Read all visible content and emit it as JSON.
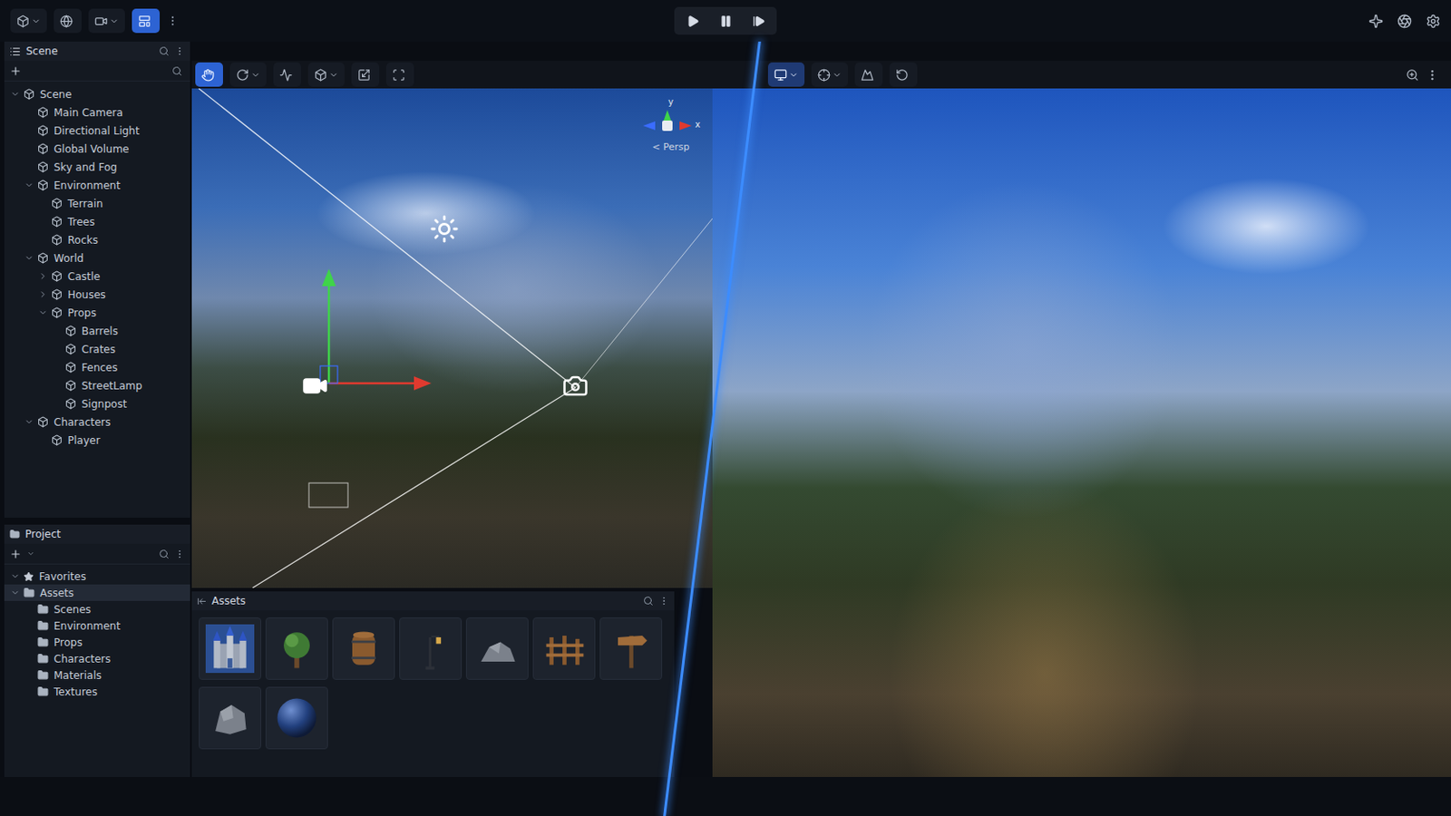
{
  "top_bar": {
    "left_tools": [
      {
        "kind": "cube",
        "dropdown": true,
        "selected": false
      },
      {
        "kind": "globe",
        "dropdown": false,
        "selected": false
      },
      {
        "kind": "camera",
        "dropdown": true,
        "selected": false
      },
      {
        "kind": "layout",
        "dropdown": false,
        "selected": true
      }
    ],
    "playback": [
      {
        "kind": "play"
      },
      {
        "kind": "pause"
      },
      {
        "kind": "step"
      }
    ],
    "right_tools": [
      {
        "kind": "sparkle"
      },
      {
        "kind": "aperture"
      },
      {
        "kind": "settings"
      }
    ]
  },
  "hierarchy": {
    "title": "Scene",
    "search": {
      "placeholder": ""
    },
    "items": [
      {
        "label": "Scene",
        "expandable": true,
        "expanded": true,
        "selected": false,
        "children": [
          {
            "label": "Main Camera",
            "expandable": false,
            "expanded": false,
            "selected": false,
            "children": []
          },
          {
            "label": "Directional Light",
            "expandable": false,
            "expanded": false,
            "selected": false,
            "children": []
          },
          {
            "label": "Global Volume",
            "expandable": false,
            "expanded": false,
            "selected": false,
            "children": []
          },
          {
            "label": "Sky and Fog",
            "expandable": false,
            "expanded": false,
            "selected": false,
            "children": []
          },
          {
            "label": "Environment",
            "expandable": true,
            "expanded": true,
            "selected": false,
            "children": [
              {
                "label": "Terrain",
                "expandable": false,
                "expanded": false,
                "selected": false,
                "children": []
              },
              {
                "label": "Trees",
                "expandable": false,
                "expanded": false,
                "selected": false,
                "children": []
              },
              {
                "label": "Rocks",
                "expandable": false,
                "expanded": false,
                "selected": false,
                "children": []
              }
            ]
          },
          {
            "label": "World",
            "expandable": true,
            "expanded": true,
            "selected": false,
            "children": [
              {
                "label": "Castle",
                "expandable": true,
                "expanded": false,
                "selected": false,
                "children": []
              },
              {
                "label": "Houses",
                "expandable": true,
                "expanded": false,
                "selected": false,
                "children": []
              },
              {
                "label": "Props",
                "expandable": true,
                "expanded": true,
                "selected": false,
                "children": [
                  {
                    "label": "Barrels",
                    "expandable": false,
                    "expanded": false,
                    "selected": false,
                    "children": []
                  },
                  {
                    "label": "Crates",
                    "expandable": false,
                    "expanded": false,
                    "selected": false,
                    "children": []
                  },
                  {
                    "label": "Fences",
                    "expandable": false,
                    "expanded": false,
                    "selected": false,
                    "children": []
                  },
                  {
                    "label": "StreetLamp",
                    "expandable": false,
                    "expanded": false,
                    "selected": false,
                    "children": []
                  },
                  {
                    "label": "Signpost",
                    "expandable": false,
                    "expanded": false,
                    "selected": false,
                    "children": []
                  }
                ]
              }
            ]
          },
          {
            "label": "Characters",
            "expandable": true,
            "expanded": true,
            "selected": false,
            "children": [
              {
                "label": "Player",
                "expandable": false,
                "expanded": false,
                "selected": false,
                "children": []
              }
            ]
          }
        ]
      }
    ]
  },
  "project": {
    "title": "Project",
    "tree": [
      {
        "label": "Favorites",
        "kind": "favorites",
        "expandable": true,
        "expanded": true,
        "selected": false,
        "children": []
      },
      {
        "label": "Assets",
        "kind": "folder",
        "expandable": true,
        "expanded": true,
        "selected": true,
        "children": [
          {
            "label": "Scenes",
            "kind": "folder",
            "expandable": false,
            "expanded": false,
            "selected": false,
            "children": []
          },
          {
            "label": "Environment",
            "kind": "folder",
            "expandable": false,
            "expanded": false,
            "selected": false,
            "children": []
          },
          {
            "label": "Props",
            "kind": "folder",
            "expandable": false,
            "expanded": false,
            "selected": false,
            "children": []
          },
          {
            "label": "Characters",
            "kind": "folder",
            "expandable": false,
            "expanded": false,
            "selected": false,
            "children": []
          },
          {
            "label": "Materials",
            "kind": "folder",
            "expandable": false,
            "expanded": false,
            "selected": false,
            "children": []
          },
          {
            "label": "Textures",
            "kind": "folder",
            "expandable": false,
            "expanded": false,
            "selected": false,
            "children": []
          }
        ]
      }
    ]
  },
  "scene_view": {
    "tools": [
      {
        "kind": "hand",
        "dropdown": false,
        "selected": true
      },
      {
        "kind": "rotate",
        "dropdown": true,
        "selected": false
      },
      {
        "kind": "scale",
        "dropdown": false,
        "selected": false
      },
      {
        "kind": "cube",
        "dropdown": true,
        "selected": false
      },
      {
        "kind": "move",
        "dropdown": false,
        "selected": false
      },
      {
        "kind": "frame",
        "dropdown": false,
        "selected": false
      }
    ],
    "gizmo": {
      "y": "y",
      "x": "x",
      "projection": "< Persp"
    }
  },
  "game_view": {
    "tools": [
      {
        "kind": "display",
        "dropdown": true,
        "selected": true
      },
      {
        "kind": "gizmos",
        "dropdown": true,
        "selected": false
      },
      {
        "kind": "terrain",
        "dropdown": false,
        "selected": false
      },
      {
        "kind": "refresh",
        "dropdown": false,
        "selected": false
      }
    ],
    "right_tools": [
      {
        "kind": "zoom"
      },
      {
        "kind": "more"
      }
    ]
  },
  "assets": {
    "title": "Assets",
    "items": [
      {
        "kind": "castle"
      },
      {
        "kind": "tree"
      },
      {
        "kind": "barrel"
      },
      {
        "kind": "lamp"
      },
      {
        "kind": "rock"
      },
      {
        "kind": "fence"
      },
      {
        "kind": "sign"
      },
      {
        "kind": "rock"
      },
      {
        "kind": "sphere"
      }
    ]
  }
}
